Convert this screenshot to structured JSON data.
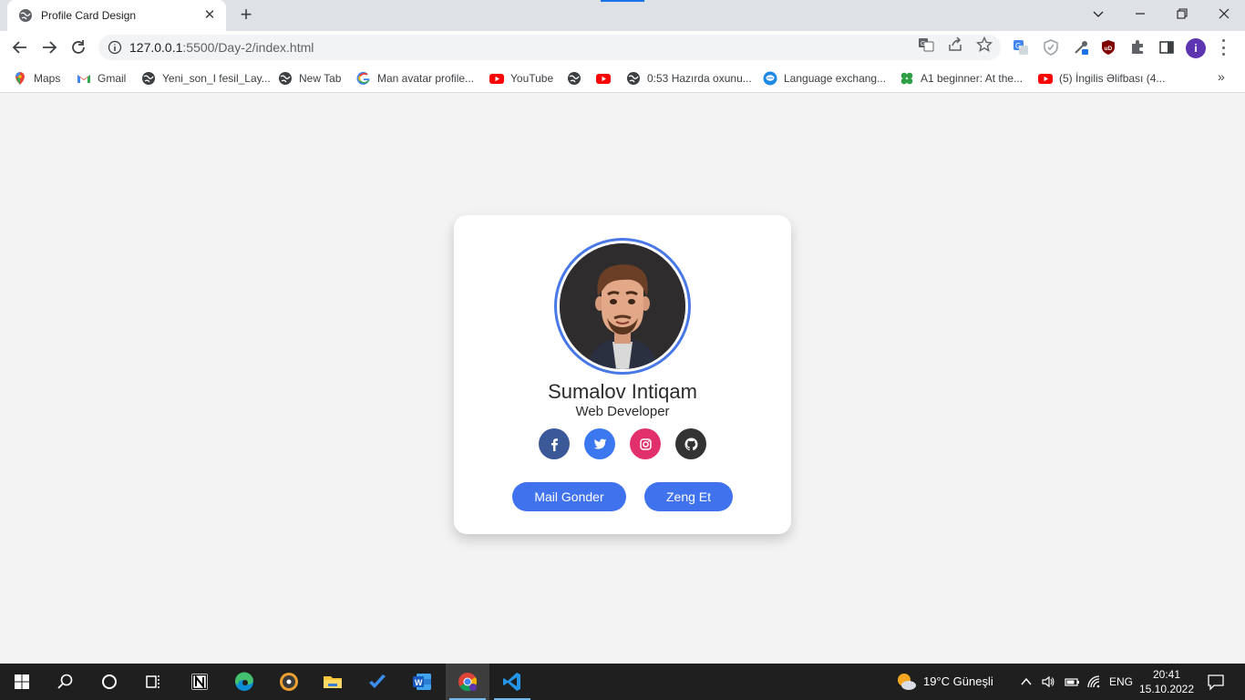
{
  "browser": {
    "tab_title": "Profile Card Design",
    "url_host": "127.0.0.1",
    "url_rest": ":5500/Day-2/index.html",
    "bookmarks": [
      {
        "label": "Maps",
        "icon": "maps-icon"
      },
      {
        "label": "Gmail",
        "icon": "gmail-icon"
      },
      {
        "label": "Yeni_son_I fesil_Lay...",
        "icon": "globe-icon"
      },
      {
        "label": "New Tab",
        "icon": "globe-icon"
      },
      {
        "label": "Man avatar profile...",
        "icon": "google-icon"
      },
      {
        "label": "YouTube",
        "icon": "youtube-icon"
      },
      {
        "label": "",
        "icon": "globe-icon"
      },
      {
        "label": "",
        "icon": "youtube-icon"
      },
      {
        "label": "0:53 Hazırda oxunu...",
        "icon": "globe-icon"
      },
      {
        "label": "Language exchang...",
        "icon": "chat-icon"
      },
      {
        "label": "A1 beginner: At the...",
        "icon": "clover-icon"
      },
      {
        "label": "(5) İngilis Əlifbası (4...",
        "icon": "youtube-icon"
      }
    ],
    "profile_initial": "i"
  },
  "card": {
    "name": "Sumalov Intiqam",
    "role": "Web Developer",
    "socials": [
      {
        "icon": "facebook-icon",
        "color": "#3b5998"
      },
      {
        "icon": "twitter-icon",
        "color": "#3b78f0"
      },
      {
        "icon": "instagram-icon",
        "color": "#e1306c"
      },
      {
        "icon": "github-icon",
        "color": "#333333"
      }
    ],
    "mail_button": "Mail Gonder",
    "call_button": "Zeng Et",
    "accent": "#4072ee"
  },
  "taskbar": {
    "weather": "19°C  Güneşli",
    "language": "ENG",
    "time": "20:41",
    "date": "15.10.2022"
  }
}
